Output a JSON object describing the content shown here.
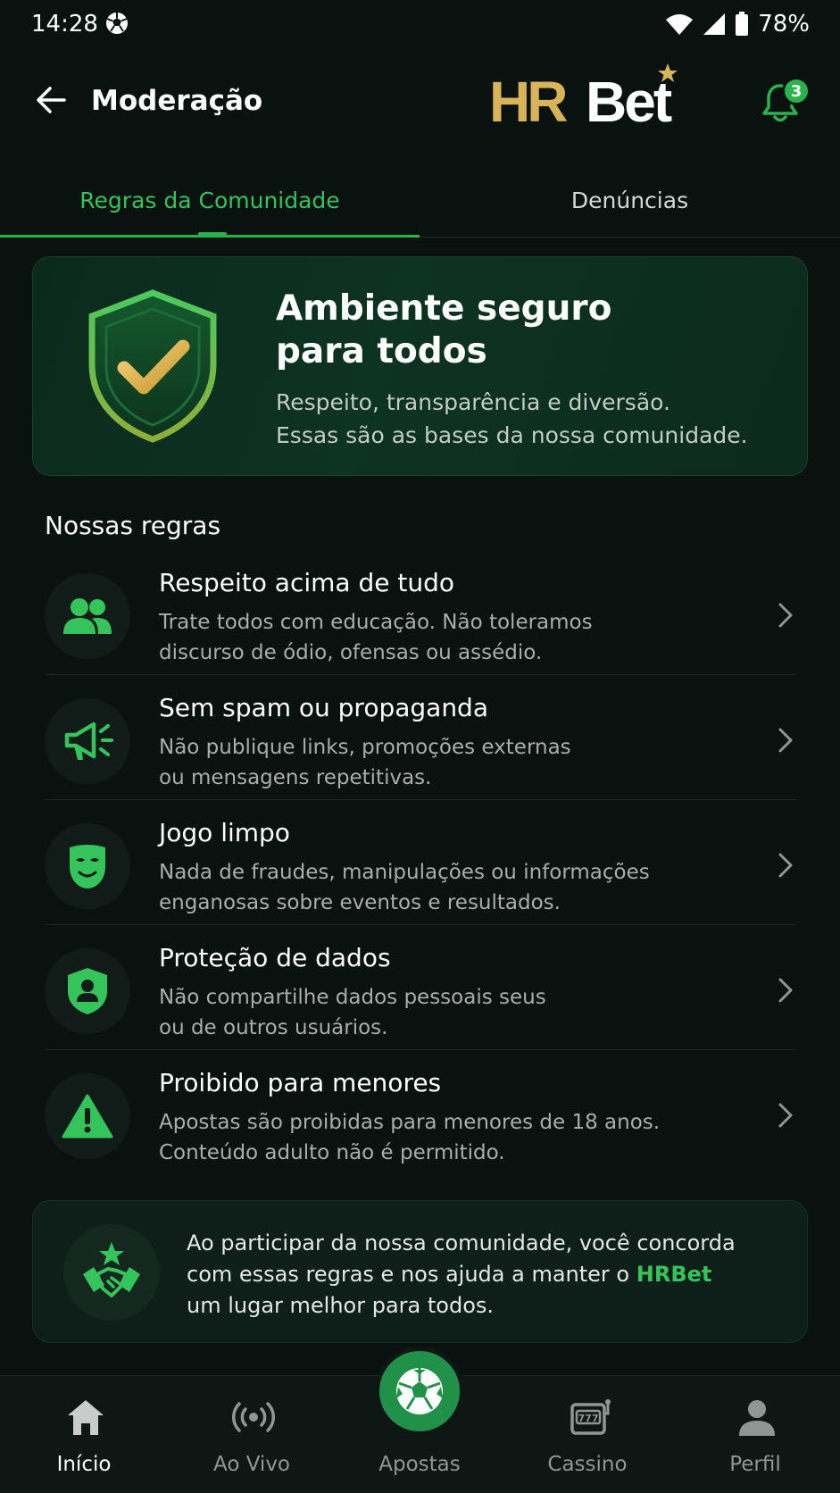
{
  "status_bar": {
    "time": "14:28",
    "battery": "78%"
  },
  "header": {
    "title": "Moderação",
    "logo_hr": "HR",
    "logo_bet": "Bet",
    "notification_count": "3"
  },
  "tabs": [
    {
      "label": "Regras da Comunidade",
      "active": true
    },
    {
      "label": "Denúncias",
      "active": false
    }
  ],
  "hero": {
    "title_line1": "Ambiente seguro",
    "title_line2": "para todos",
    "desc_line1": "Respeito, transparência e diversão.",
    "desc_line2": "Essas são as bases da nossa comunidade."
  },
  "rules_section": {
    "title": "Nossas regras",
    "items": [
      {
        "icon": "users-icon",
        "title": "Respeito acima de tudo",
        "line1": "Trate todos com educação. Não toleramos",
        "line2": "discurso de ódio, ofensas ou assédio."
      },
      {
        "icon": "megaphone-icon",
        "title": "Sem spam ou propaganda",
        "line1": "Não publique links, promoções externas",
        "line2": "ou mensagens repetitivas."
      },
      {
        "icon": "mask-icon",
        "title": "Jogo limpo",
        "line1": "Nada de fraudes, manipulações ou informações",
        "line2": "enganosas sobre eventos e resultados."
      },
      {
        "icon": "shield-user-icon",
        "title": "Proteção de dados",
        "line1": "Não compartilhe dados pessoais seus",
        "line2": "ou de outros usuários."
      },
      {
        "icon": "warning-icon",
        "title": "Proibido para menores",
        "line1": "Apostas são proibidas para menores de 18 anos.",
        "line2": "Conteúdo adulto não é permitido."
      }
    ]
  },
  "notice": {
    "line1": "Ao participar da nossa comunidade, você concorda",
    "line2_prefix": "com essas regras e nos ajuda a manter o ",
    "brand": "HRBet",
    "line3": "um lugar melhor para todos."
  },
  "bottom_nav": [
    {
      "label": "Início",
      "icon": "home-icon",
      "active": true
    },
    {
      "label": "Ao Vivo",
      "icon": "live-icon",
      "active": false
    },
    {
      "label": "Apostas",
      "icon": "soccer-ball-icon",
      "active": false
    },
    {
      "label": "Cassino",
      "icon": "slot-machine-icon",
      "active": false
    },
    {
      "label": "Perfil",
      "icon": "profile-icon",
      "active": false
    }
  ],
  "colors": {
    "accent": "#2bb24c",
    "accent_text": "#35c45c",
    "gold": "#d8b35a",
    "background": "#0a1210"
  }
}
